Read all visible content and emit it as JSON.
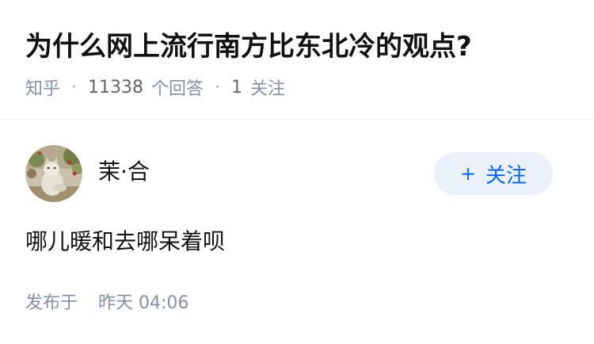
{
  "question": {
    "title": "为什么网上流行南方比东北冷的观点?",
    "source": "知乎",
    "answer_count": "11338",
    "answer_label": "个回答",
    "follow_count": "1",
    "follow_label": "关注"
  },
  "answer": {
    "author_name": "茉·合",
    "follow_button": {
      "icon": "plus-icon",
      "label": "关注"
    },
    "content": "哪儿暖和去哪呆着呗",
    "publish_label": "发布于",
    "publish_time": "昨天 04:06"
  },
  "colors": {
    "title": "#121212",
    "meta": "#8590a6",
    "accent": "#0066ff",
    "follow_button_bg": "#eaf1fb",
    "divider": "#ebebeb"
  }
}
